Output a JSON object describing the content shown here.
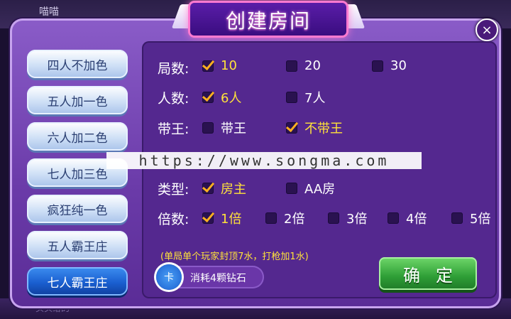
{
  "background": {
    "top_left_name": "喵喵",
    "bottom_left_text": "头头给的",
    "bottom_right_text": "...."
  },
  "dialog": {
    "title": "创建房间",
    "close_glyph": "×"
  },
  "sidebar": {
    "tabs": [
      {
        "label": "四人不加色",
        "active": false
      },
      {
        "label": "五人加一色",
        "active": false
      },
      {
        "label": "六人加二色",
        "active": false
      },
      {
        "label": "七人加三色",
        "active": false
      },
      {
        "label": "疯狂纯一色",
        "active": false
      },
      {
        "label": "五人霸王庄",
        "active": false
      },
      {
        "label": "七人霸王庄",
        "active": true
      }
    ]
  },
  "settings": {
    "rounds": {
      "label": "局数:",
      "options": [
        {
          "text": "10",
          "checked": true
        },
        {
          "text": "20",
          "checked": false
        },
        {
          "text": "30",
          "checked": false
        }
      ]
    },
    "players": {
      "label": "人数:",
      "options": [
        {
          "text": "6人",
          "checked": true
        },
        {
          "text": "7人",
          "checked": false
        }
      ]
    },
    "king": {
      "label": "带王:",
      "options": [
        {
          "text": "带王",
          "checked": false
        },
        {
          "text": "不带王",
          "checked": true
        }
      ]
    },
    "type": {
      "label": "类型:",
      "options": [
        {
          "text": "房主",
          "checked": true
        },
        {
          "text": "AA房",
          "checked": false
        }
      ]
    },
    "multiplier": {
      "label": "倍数:",
      "options": [
        {
          "text": "1倍",
          "checked": true
        },
        {
          "text": "2倍",
          "checked": false
        },
        {
          "text": "3倍",
          "checked": false
        },
        {
          "text": "4倍",
          "checked": false
        },
        {
          "text": "5倍",
          "checked": false
        }
      ]
    }
  },
  "watermark": "https://www.songma.com",
  "note": "(单局单个玩家封顶7水，打枪加1水)",
  "cost": {
    "icon_text": "卡",
    "text": "消耗4颗钻石"
  },
  "confirm_label": "确定",
  "colors": {
    "selected_text": "#ffe23a",
    "checkmark": "#ffb020",
    "confirm_green": "#2e9e36",
    "active_tab": "#1a5fd0"
  }
}
